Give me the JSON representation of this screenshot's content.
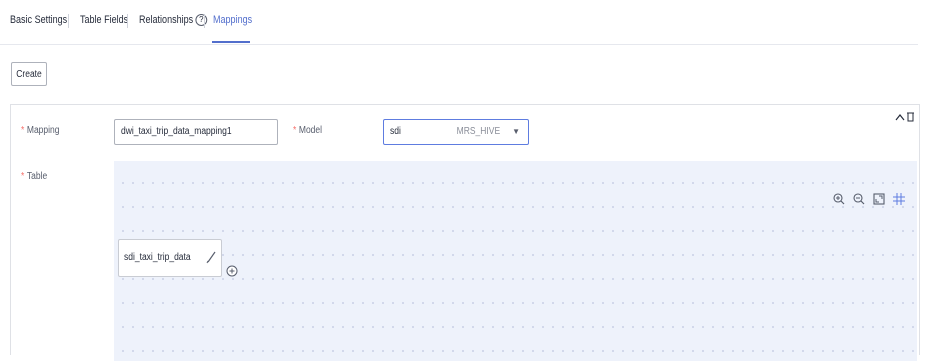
{
  "tabs": [
    {
      "label": "Basic Settings"
    },
    {
      "label": "Table Fields"
    },
    {
      "label": "Relationships"
    },
    {
      "label": "Mappings"
    }
  ],
  "toolbar": {
    "create_label": "Create"
  },
  "form": {
    "mapping_label": "Mapping",
    "mapping_value": "dwi_taxi_trip_data_mapping1",
    "model_label": "Model",
    "model_value": "sdi",
    "model_type": "MRS_HIVE",
    "table_label": "Table",
    "required_mark": "*"
  },
  "canvas": {
    "node_name": "sdi_taxi_trip_data"
  },
  "icons": {
    "help": "help-circle-icon",
    "zoom_in": "zoom-in-icon",
    "zoom_out": "zoom-out-icon",
    "fit": "fit-screen-icon",
    "grid": "grid-icon",
    "edit": "pencil-icon",
    "add": "plus-circle-icon",
    "collapse": "chevron-up-icon",
    "delete": "trash-icon"
  },
  "colors": {
    "accent": "#526ecc",
    "required": "#f66f6a",
    "canvas_bg": "#eef2fb"
  }
}
